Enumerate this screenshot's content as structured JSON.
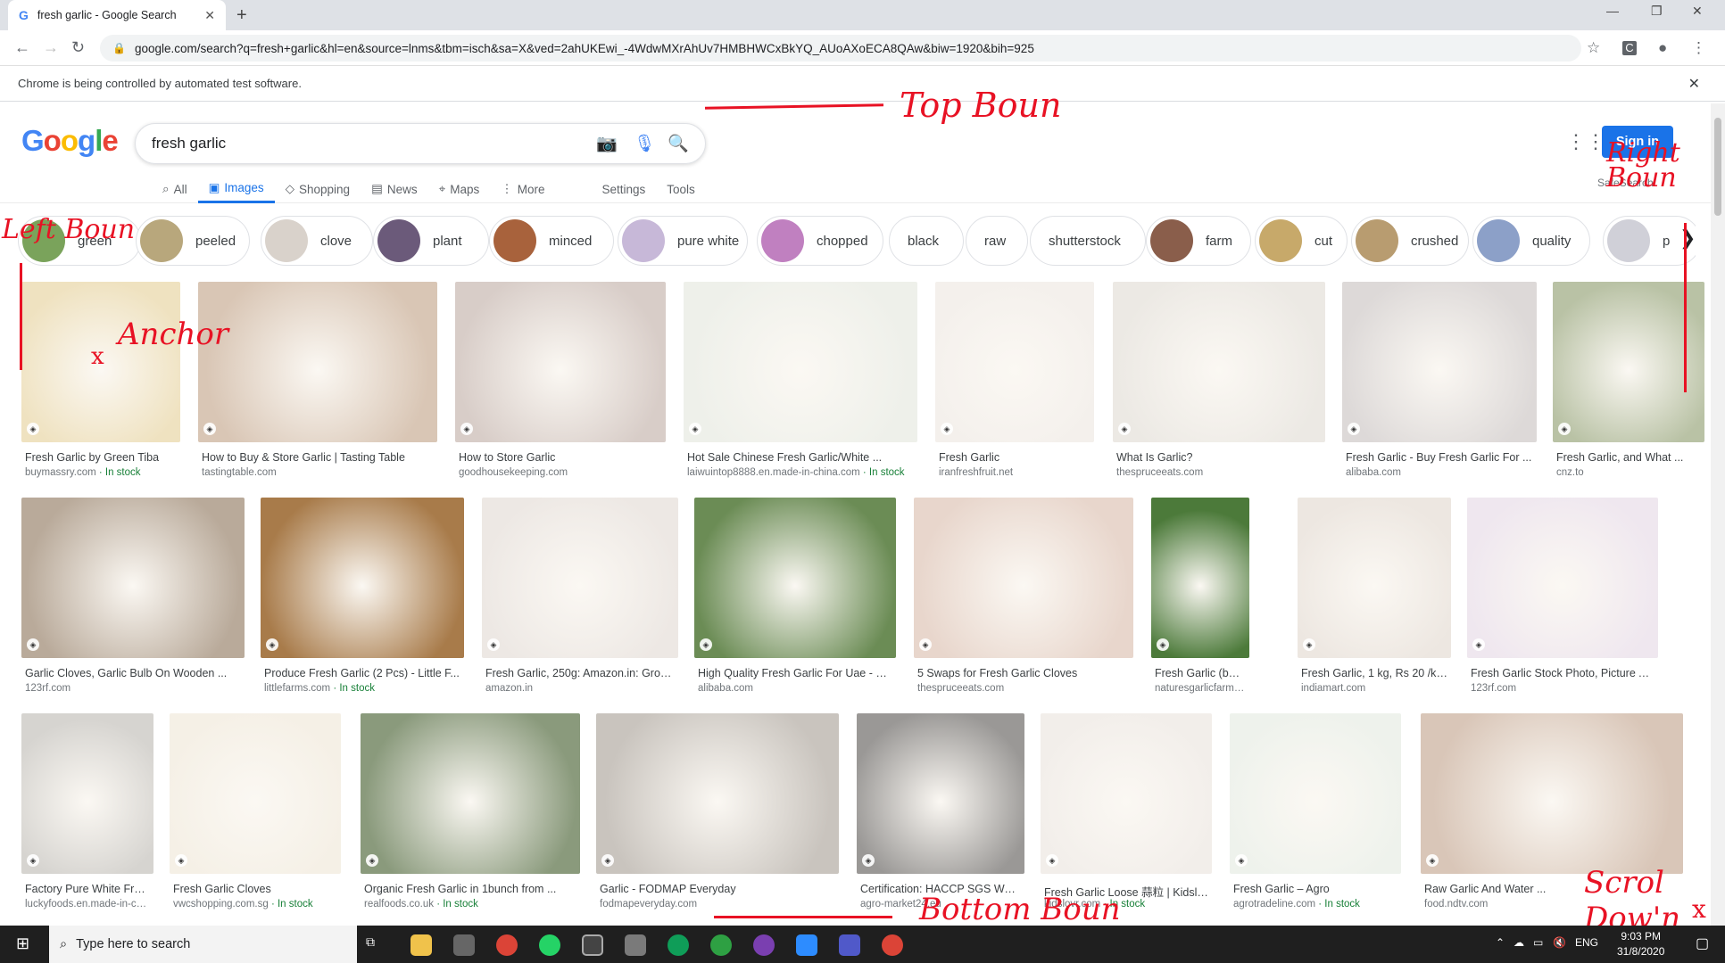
{
  "browser": {
    "tab_title": "fresh garlic - Google Search",
    "url": "google.com/search?q=fresh+garlic&hl=en&source=lnms&tbm=isch&sa=X&ved=2ahUKEwi_-4WdwMXrAhUv7HMBHWCxBkYQ_AUoAXoECA8QAw&biw=1920&bih=925",
    "infobar_text": "Chrome is being controlled by automated test software."
  },
  "google": {
    "logo": "Google",
    "query": "fresh garlic",
    "tabs": [
      {
        "label": "All",
        "icon": "search-icon"
      },
      {
        "label": "Images",
        "icon": "image-icon"
      },
      {
        "label": "Shopping",
        "icon": "tag-icon"
      },
      {
        "label": "News",
        "icon": "news-icon"
      },
      {
        "label": "Maps",
        "icon": "pin-icon"
      },
      {
        "label": "More",
        "icon": "more-icon"
      },
      {
        "label": "Settings",
        "icon": ""
      },
      {
        "label": "Tools",
        "icon": ""
      }
    ],
    "active_tab": "Images",
    "sign_in": "Sign in",
    "safesearch": "SafeSearch"
  },
  "chips": [
    {
      "label": "green"
    },
    {
      "label": "peeled"
    },
    {
      "label": "clove"
    },
    {
      "label": "plant"
    },
    {
      "label": "minced"
    },
    {
      "label": "pure white"
    },
    {
      "label": "chopped"
    },
    {
      "label": "black"
    },
    {
      "label": "raw"
    },
    {
      "label": "shutterstock"
    },
    {
      "label": "farm"
    },
    {
      "label": "cut"
    },
    {
      "label": "crushed"
    },
    {
      "label": "quality"
    },
    {
      "label": "p"
    }
  ],
  "results": [
    {
      "title": "Fresh Garlic by Green Tiba",
      "source": "buymassry.com",
      "stock": "In stock"
    },
    {
      "title": "How to Buy & Store Garlic | Tasting Table",
      "source": "tastingtable.com",
      "stock": ""
    },
    {
      "title": "How to Store Garlic",
      "source": "goodhousekeeping.com",
      "stock": ""
    },
    {
      "title": "Hot Sale Chinese Fresh Garlic/White ...",
      "source": "laiwuintop8888.en.made-in-china.com",
      "stock": "In stock"
    },
    {
      "title": "Fresh Garlic",
      "source": "iranfreshfruit.net",
      "stock": ""
    },
    {
      "title": "What Is Garlic?",
      "source": "thespruceeats.com",
      "stock": ""
    },
    {
      "title": "Fresh Garlic - Buy Fresh Garlic For ...",
      "source": "alibaba.com",
      "stock": ""
    },
    {
      "title": "Fresh Garlic, and What ...",
      "source": "cnz.to",
      "stock": ""
    },
    {
      "title": "Garlic Cloves, Garlic Bulb On Wooden ...",
      "source": "123rf.com",
      "stock": ""
    },
    {
      "title": "Produce Fresh Garlic (2 Pcs) - Little F...",
      "source": "littlefarms.com",
      "stock": "In stock"
    },
    {
      "title": "Fresh Garlic, 250g: Amazon.in: Groce...",
      "source": "amazon.in",
      "stock": ""
    },
    {
      "title": "High Quality Fresh Garlic For Uae - Bu...",
      "source": "alibaba.com",
      "stock": ""
    },
    {
      "title": "5 Swaps for Fresh Garlic Cloves",
      "source": "thespruceeats.com",
      "stock": ""
    },
    {
      "title": "Fresh Garlic (bulb & sta...",
      "source": "naturesgarlicfarm.com · I...",
      "stock": ""
    },
    {
      "title": "Fresh Garlic, 1 kg, Rs 20 /kil...",
      "source": "indiamart.com",
      "stock": ""
    },
    {
      "title": "Fresh Garlic Stock Photo, Picture And ...",
      "source": "123rf.com",
      "stock": ""
    },
    {
      "title": "Factory Pure White Fres...",
      "source": "luckyfoods.en.made-in-ch...",
      "stock": ""
    },
    {
      "title": "Fresh Garlic Cloves",
      "source": "vwcshopping.com.sg",
      "stock": "In stock"
    },
    {
      "title": "Organic Fresh Garlic in 1bunch from ...",
      "source": "realfoods.co.uk",
      "stock": "In stock"
    },
    {
      "title": "Garlic - FODMAP Everyday",
      "source": "fodmapeveryday.com",
      "stock": ""
    },
    {
      "title": "Certification: HACCP SGS Wei...",
      "source": "agro-market24.eu",
      "stock": ""
    },
    {
      "title": "Fresh Garlic Loose 蒜粒 | Kidslo...",
      "source": "kidslovr.com",
      "stock": "In stock"
    },
    {
      "title": "Fresh Garlic – Agro",
      "source": "agrotradeline.com",
      "stock": "In stock"
    },
    {
      "title": "Raw Garlic And Water ...",
      "source": "food.ndtv.com",
      "stock": ""
    }
  ],
  "annotations": {
    "top": "Top Boun",
    "right": "Right Boun",
    "left": "Left Boun",
    "anchor": "Anchor",
    "bottom": "Bottom Boun",
    "scroll": "Scrol Dow'n",
    "anchor_mark": "x",
    "scroll_mark": "x",
    "color": "#e81224"
  },
  "taskbar": {
    "search_placeholder": "Type here to search",
    "lang": "ENG",
    "time": "9:03 PM",
    "date": "31/8/2020"
  }
}
